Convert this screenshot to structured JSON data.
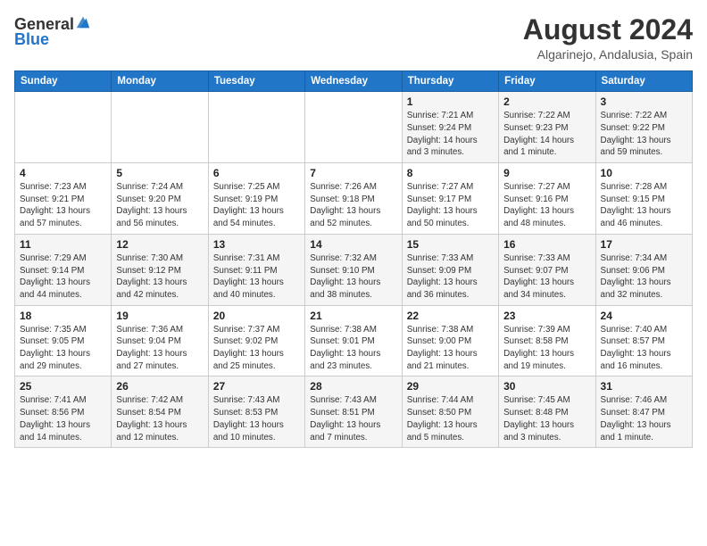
{
  "header": {
    "logo_general": "General",
    "logo_blue": "Blue",
    "main_title": "August 2024",
    "subtitle": "Algarinejo, Andalusia, Spain"
  },
  "weekdays": [
    "Sunday",
    "Monday",
    "Tuesday",
    "Wednesday",
    "Thursday",
    "Friday",
    "Saturday"
  ],
  "weeks": [
    [
      {
        "day": "",
        "info": ""
      },
      {
        "day": "",
        "info": ""
      },
      {
        "day": "",
        "info": ""
      },
      {
        "day": "",
        "info": ""
      },
      {
        "day": "1",
        "info": "Sunrise: 7:21 AM\nSunset: 9:24 PM\nDaylight: 14 hours\nand 3 minutes."
      },
      {
        "day": "2",
        "info": "Sunrise: 7:22 AM\nSunset: 9:23 PM\nDaylight: 14 hours\nand 1 minute."
      },
      {
        "day": "3",
        "info": "Sunrise: 7:22 AM\nSunset: 9:22 PM\nDaylight: 13 hours\nand 59 minutes."
      }
    ],
    [
      {
        "day": "4",
        "info": "Sunrise: 7:23 AM\nSunset: 9:21 PM\nDaylight: 13 hours\nand 57 minutes."
      },
      {
        "day": "5",
        "info": "Sunrise: 7:24 AM\nSunset: 9:20 PM\nDaylight: 13 hours\nand 56 minutes."
      },
      {
        "day": "6",
        "info": "Sunrise: 7:25 AM\nSunset: 9:19 PM\nDaylight: 13 hours\nand 54 minutes."
      },
      {
        "day": "7",
        "info": "Sunrise: 7:26 AM\nSunset: 9:18 PM\nDaylight: 13 hours\nand 52 minutes."
      },
      {
        "day": "8",
        "info": "Sunrise: 7:27 AM\nSunset: 9:17 PM\nDaylight: 13 hours\nand 50 minutes."
      },
      {
        "day": "9",
        "info": "Sunrise: 7:27 AM\nSunset: 9:16 PM\nDaylight: 13 hours\nand 48 minutes."
      },
      {
        "day": "10",
        "info": "Sunrise: 7:28 AM\nSunset: 9:15 PM\nDaylight: 13 hours\nand 46 minutes."
      }
    ],
    [
      {
        "day": "11",
        "info": "Sunrise: 7:29 AM\nSunset: 9:14 PM\nDaylight: 13 hours\nand 44 minutes."
      },
      {
        "day": "12",
        "info": "Sunrise: 7:30 AM\nSunset: 9:12 PM\nDaylight: 13 hours\nand 42 minutes."
      },
      {
        "day": "13",
        "info": "Sunrise: 7:31 AM\nSunset: 9:11 PM\nDaylight: 13 hours\nand 40 minutes."
      },
      {
        "day": "14",
        "info": "Sunrise: 7:32 AM\nSunset: 9:10 PM\nDaylight: 13 hours\nand 38 minutes."
      },
      {
        "day": "15",
        "info": "Sunrise: 7:33 AM\nSunset: 9:09 PM\nDaylight: 13 hours\nand 36 minutes."
      },
      {
        "day": "16",
        "info": "Sunrise: 7:33 AM\nSunset: 9:07 PM\nDaylight: 13 hours\nand 34 minutes."
      },
      {
        "day": "17",
        "info": "Sunrise: 7:34 AM\nSunset: 9:06 PM\nDaylight: 13 hours\nand 32 minutes."
      }
    ],
    [
      {
        "day": "18",
        "info": "Sunrise: 7:35 AM\nSunset: 9:05 PM\nDaylight: 13 hours\nand 29 minutes."
      },
      {
        "day": "19",
        "info": "Sunrise: 7:36 AM\nSunset: 9:04 PM\nDaylight: 13 hours\nand 27 minutes."
      },
      {
        "day": "20",
        "info": "Sunrise: 7:37 AM\nSunset: 9:02 PM\nDaylight: 13 hours\nand 25 minutes."
      },
      {
        "day": "21",
        "info": "Sunrise: 7:38 AM\nSunset: 9:01 PM\nDaylight: 13 hours\nand 23 minutes."
      },
      {
        "day": "22",
        "info": "Sunrise: 7:38 AM\nSunset: 9:00 PM\nDaylight: 13 hours\nand 21 minutes."
      },
      {
        "day": "23",
        "info": "Sunrise: 7:39 AM\nSunset: 8:58 PM\nDaylight: 13 hours\nand 19 minutes."
      },
      {
        "day": "24",
        "info": "Sunrise: 7:40 AM\nSunset: 8:57 PM\nDaylight: 13 hours\nand 16 minutes."
      }
    ],
    [
      {
        "day": "25",
        "info": "Sunrise: 7:41 AM\nSunset: 8:56 PM\nDaylight: 13 hours\nand 14 minutes."
      },
      {
        "day": "26",
        "info": "Sunrise: 7:42 AM\nSunset: 8:54 PM\nDaylight: 13 hours\nand 12 minutes."
      },
      {
        "day": "27",
        "info": "Sunrise: 7:43 AM\nSunset: 8:53 PM\nDaylight: 13 hours\nand 10 minutes."
      },
      {
        "day": "28",
        "info": "Sunrise: 7:43 AM\nSunset: 8:51 PM\nDaylight: 13 hours\nand 7 minutes."
      },
      {
        "day": "29",
        "info": "Sunrise: 7:44 AM\nSunset: 8:50 PM\nDaylight: 13 hours\nand 5 minutes."
      },
      {
        "day": "30",
        "info": "Sunrise: 7:45 AM\nSunset: 8:48 PM\nDaylight: 13 hours\nand 3 minutes."
      },
      {
        "day": "31",
        "info": "Sunrise: 7:46 AM\nSunset: 8:47 PM\nDaylight: 13 hours\nand 1 minute."
      }
    ]
  ]
}
